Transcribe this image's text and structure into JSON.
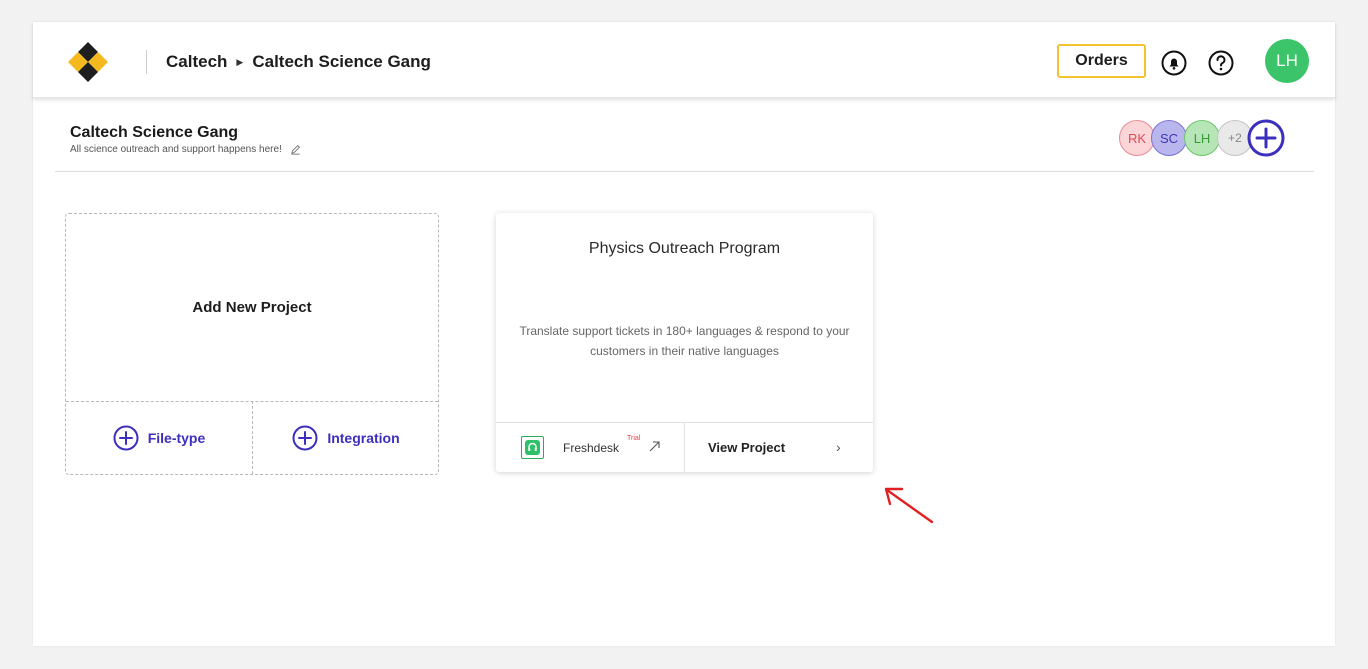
{
  "header": {
    "breadcrumb": {
      "org": "Caltech",
      "separator_icon": "caret-right-icon",
      "workspace": "Caltech Science Gang"
    },
    "orders_label": "Orders",
    "notifications_icon": "bell-icon",
    "help_icon": "help-icon",
    "user_avatar_initials": "LH",
    "user_avatar_color": "#3cc46a"
  },
  "workspace": {
    "title": "Caltech Science Gang",
    "description": "All science outreach and support happens here!",
    "edit_icon": "pencil-icon",
    "members": [
      {
        "initials": "RK",
        "color": "#fbd5d7"
      },
      {
        "initials": "SC",
        "color": "#b9b6ee"
      },
      {
        "initials": "LH",
        "color": "#b6e6b6"
      }
    ],
    "more_members": "+2",
    "add_member_icon": "plus-circle-icon"
  },
  "add_project": {
    "title": "Add New Project",
    "options": [
      {
        "label": "File-type",
        "icon": "plus-circle-icon"
      },
      {
        "label": "Integration",
        "icon": "plus-circle-icon"
      }
    ]
  },
  "projects": [
    {
      "name": "Physics Outreach Program",
      "description": "Translate support tickets in 180+ languages & respond to your customers in their native languages",
      "integration": {
        "name": "Freshdesk",
        "badge": "Trial",
        "icon": "freshdesk-icon"
      },
      "view_label": "View Project"
    }
  ],
  "colors": {
    "accent": "#3d2fbd",
    "orders_border": "#f2c230",
    "annotation_arrow": "#e02020"
  }
}
